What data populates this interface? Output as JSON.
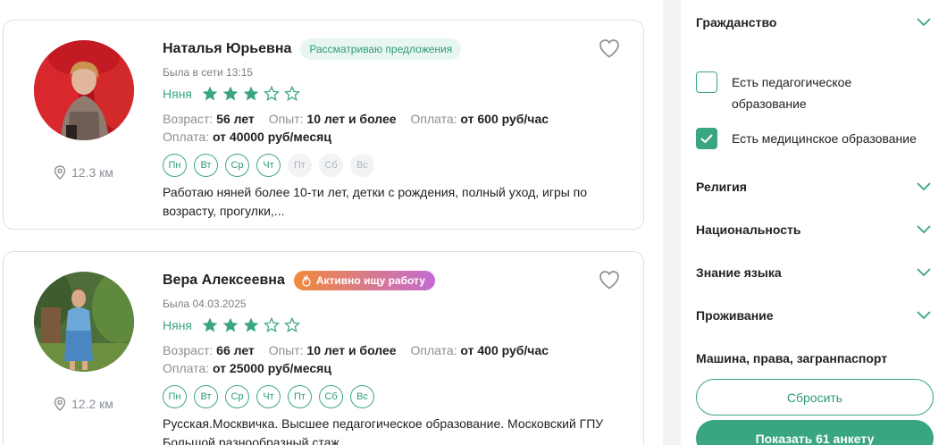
{
  "colors": {
    "accent": "#3aa583",
    "accent_light": "#e8f6f1",
    "active_gradient_start": "#f08a3c",
    "active_gradient_end": "#c46bd3"
  },
  "cards": [
    {
      "name": "Наталья Юрьевна",
      "status_badge": "Рассматриваю предложения",
      "last_seen": "Была в сети 13:15",
      "role": "Няня",
      "rating": 3,
      "max_rating": 5,
      "age_label": "Возраст:",
      "age_value": "56 лет",
      "experience_label": "Опыт:",
      "experience_value": "10 лет и более",
      "pay_label": "Оплата:",
      "pay_hourly": "от 600 руб/час",
      "pay_label2": "Оплата:",
      "pay_monthly": "от 40000 руб/месяц",
      "days": [
        {
          "label": "Пн",
          "active": true
        },
        {
          "label": "Вт",
          "active": true
        },
        {
          "label": "Ср",
          "active": true
        },
        {
          "label": "Чт",
          "active": true
        },
        {
          "label": "Пт",
          "active": false
        },
        {
          "label": "Сб",
          "active": false
        },
        {
          "label": "Вс",
          "active": false
        }
      ],
      "description": "Работаю няней более 10-ти лет, детки с рождения, полный уход, игры по возрасту, прогулки,...",
      "distance": "12.3 км",
      "favorite_icon": "heart-outline-icon"
    },
    {
      "name": "Вера Алексеевна",
      "status_badge": "Активно ищу работу",
      "last_seen": "Была 04.03.2025",
      "role": "Няня",
      "rating": 3,
      "max_rating": 5,
      "age_label": "Возраст:",
      "age_value": "66 лет",
      "experience_label": "Опыт:",
      "experience_value": "10 лет и более",
      "pay_label": "Оплата:",
      "pay_hourly": "от 400 руб/час",
      "pay_label2": "Оплата:",
      "pay_monthly": "от 25000 руб/месяц",
      "days": [
        {
          "label": "Пн",
          "active": true
        },
        {
          "label": "Вт",
          "active": true
        },
        {
          "label": "Ср",
          "active": true
        },
        {
          "label": "Чт",
          "active": true
        },
        {
          "label": "Пт",
          "active": true
        },
        {
          "label": "Сб",
          "active": true
        },
        {
          "label": "Вс",
          "active": true
        }
      ],
      "description": "Русская.Москвичка. Высшее педагогическое образование. Московский ГПУ Большой разнообразный стаж...",
      "distance": "12.2 км",
      "favorite_icon": "heart-outline-icon"
    }
  ],
  "filters": {
    "citizenship": "Гражданство",
    "pedagogical_education": {
      "label": "Есть педагогическое образование",
      "checked": false
    },
    "medical_education": {
      "label": "Есть медицинское образование",
      "checked": true
    },
    "religion": "Религия",
    "nationality": "Национальность",
    "language": "Знание языка",
    "residence": "Проживание",
    "car_docs": "Машина, права, загранпаспорт",
    "reset_label": "Сбросить",
    "show_label": "Показать 61 анкету"
  }
}
